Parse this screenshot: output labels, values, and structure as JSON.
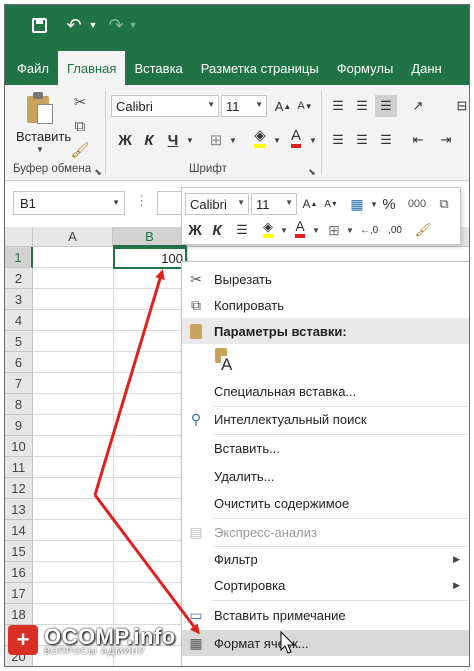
{
  "ribbon": {
    "tabs": [
      {
        "label": "Файл",
        "active": false
      },
      {
        "label": "Главная",
        "active": true
      },
      {
        "label": "Вставка",
        "active": false
      },
      {
        "label": "Разметка страницы",
        "active": false
      },
      {
        "label": "Формулы",
        "active": false
      },
      {
        "label": "Данн",
        "active": false
      }
    ],
    "paste_label": "Вставить",
    "clipboard_group": "Буфер обмена",
    "font_group": "Шрифт",
    "font_name": "Calibri",
    "font_size": "11",
    "bold": "Ж",
    "italic": "К",
    "underline": "Ч",
    "font_color_letter": "А"
  },
  "formula_bar": {
    "name_box": "B1",
    "dots": "⋮"
  },
  "grid": {
    "columns": [
      "A",
      "B"
    ],
    "rows": [
      "1",
      "2",
      "3",
      "4",
      "5",
      "6",
      "7",
      "8",
      "9",
      "10",
      "11",
      "12",
      "13",
      "14",
      "15",
      "16",
      "17",
      "18",
      "19",
      "20"
    ],
    "selected_cell_value": "100"
  },
  "mini_toolbar": {
    "font_name": "Calibri",
    "font_size": "11",
    "percent": "%",
    "thousands": "000",
    "bold": "Ж",
    "italic": "К"
  },
  "context_menu": {
    "items": [
      {
        "label": "Вырезать",
        "icon": "scissors-icon",
        "disabled": false
      },
      {
        "label": "Копировать",
        "icon": "copy-icon",
        "disabled": false
      },
      {
        "label": "Параметры вставки:",
        "icon": "paste-icon",
        "disabled": false,
        "header": true
      },
      {
        "label": "Специальная вставка...",
        "icon": "",
        "disabled": false
      },
      {
        "label": "Интеллектуальный поиск",
        "icon": "smart-lookup-icon",
        "disabled": false
      },
      {
        "label": "Вставить...",
        "icon": "",
        "disabled": false
      },
      {
        "label": "Удалить...",
        "icon": "",
        "disabled": false
      },
      {
        "label": "Очистить содержимое",
        "icon": "",
        "disabled": false
      },
      {
        "label": "Экспресс-анализ",
        "icon": "quick-analysis-icon",
        "disabled": true
      },
      {
        "label": "Фильтр",
        "icon": "",
        "disabled": false,
        "submenu": true
      },
      {
        "label": "Сортировка",
        "icon": "",
        "disabled": false,
        "submenu": true
      },
      {
        "label": "Вставить примечание",
        "icon": "comment-icon",
        "disabled": false
      },
      {
        "label": "Формат ячеек...",
        "icon": "format-cells-icon",
        "disabled": false,
        "highlighted": true
      }
    ],
    "paste_option_glyph": "A"
  },
  "watermark": {
    "title": "OCOMP.info",
    "subtitle": "ВОПРОСЫ АДМИНУ",
    "badge": "+"
  },
  "colors": {
    "excel_green": "#217346",
    "arrow_red": "#e0201e",
    "menu_highlight": "#d9d9d9"
  }
}
